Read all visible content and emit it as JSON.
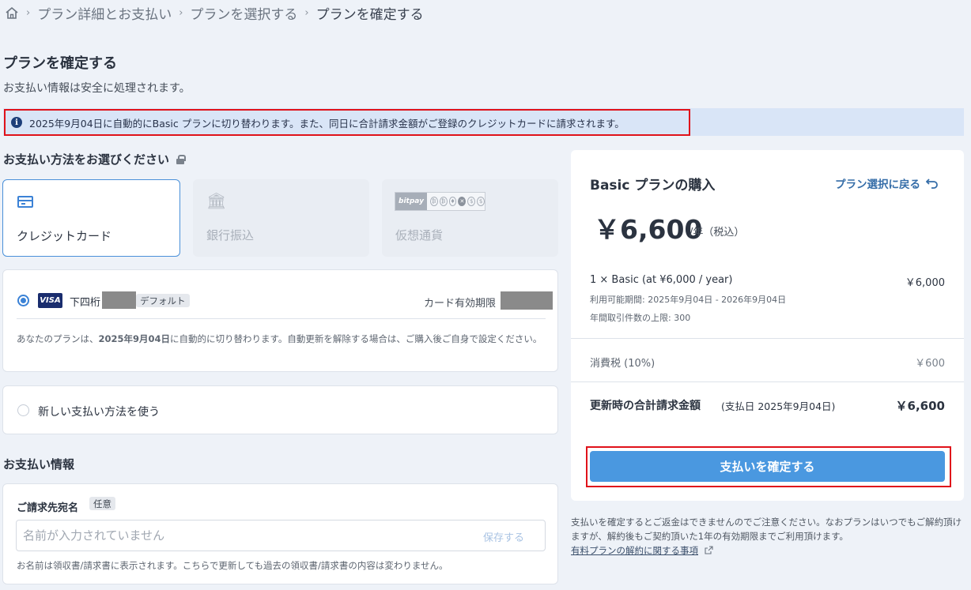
{
  "breadcrumb": {
    "home_icon": "home-icon",
    "items": [
      "プラン詳細とお支払い",
      "プランを選択する",
      "プランを確定する"
    ],
    "separator": "›"
  },
  "page": {
    "title": "プランを確定する",
    "subtitle": "お支払い情報は安全に処理されます。"
  },
  "banner": {
    "icon": "info-icon",
    "text": "2025年9月04日に自動的にBasic プランに切り替わります。また、同日に合計請求金額がご登録のクレジットカードに請求されます。"
  },
  "payment_method": {
    "title": "お支払い方法をお選びください",
    "options": [
      {
        "label": "クレジットカード",
        "icon": "credit-card-icon",
        "selected": true
      },
      {
        "label": "銀行振込",
        "icon": "bank-icon",
        "selected": false
      },
      {
        "label": "仮想通貨",
        "icon": "bitpay-logo",
        "logo_text": "bitpay",
        "selected": false
      }
    ]
  },
  "saved_card": {
    "brand": "VISA",
    "last4_label": "下四桁",
    "default_badge": "デフォルト",
    "expiry_label": "カード有効期限",
    "note_prefix": "あなたのプランは、",
    "note_date": "2025年9月04日",
    "note_suffix": "に自動的に切り替わります。自動更新を解除する場合は、ご購入後ご自身で設定ください。"
  },
  "new_method": {
    "label": "新しい支払い方法を使う"
  },
  "billing": {
    "section_title": "お支払い情報",
    "name_label": "ご請求先宛名",
    "optional_badge": "任意",
    "name_placeholder": "名前が入力されていません",
    "save_label": "保存する",
    "help_text": "お名前は領収書/請求書に表示されます。こちらで更新しても過去の領収書/請求書の内容は変わりません。"
  },
  "summary": {
    "title": "Basic プランの購入",
    "back_link": "プラン選択に戻る",
    "back_icon": "undo-arrow-icon",
    "price": "￥6,600",
    "price_unit": "/年（税込）",
    "line_item": "1 × Basic (at ¥6,000 / year)",
    "line_amount": "￥6,000",
    "period": "利用可能期間: 2025年9月04日 - 2026年9月04日",
    "limit": "年間取引件数の上限: 300",
    "tax_label": "消費税 (10%)",
    "tax_amount": "￥600",
    "total_label": "更新時の合計請求金額",
    "total_date": "(支払日 2025年9月04日)",
    "total_amount": "￥6,600",
    "confirm_button": "支払いを確定する"
  },
  "footer_note": {
    "text": "支払いを確定するとご返金はできませんのでご注意ください。なおプランはいつでもご解約頂けますが、解約後もご契約頂いた1年の有効期限までご利用頂けます。",
    "link": "有料プランの解約に関する事項",
    "link_icon": "external-link-icon"
  },
  "colors": {
    "accent": "#4a98e0",
    "highlight": "#e0121a",
    "banner_bg": "#d9e5f7",
    "page_bg": "#eef2f8"
  }
}
